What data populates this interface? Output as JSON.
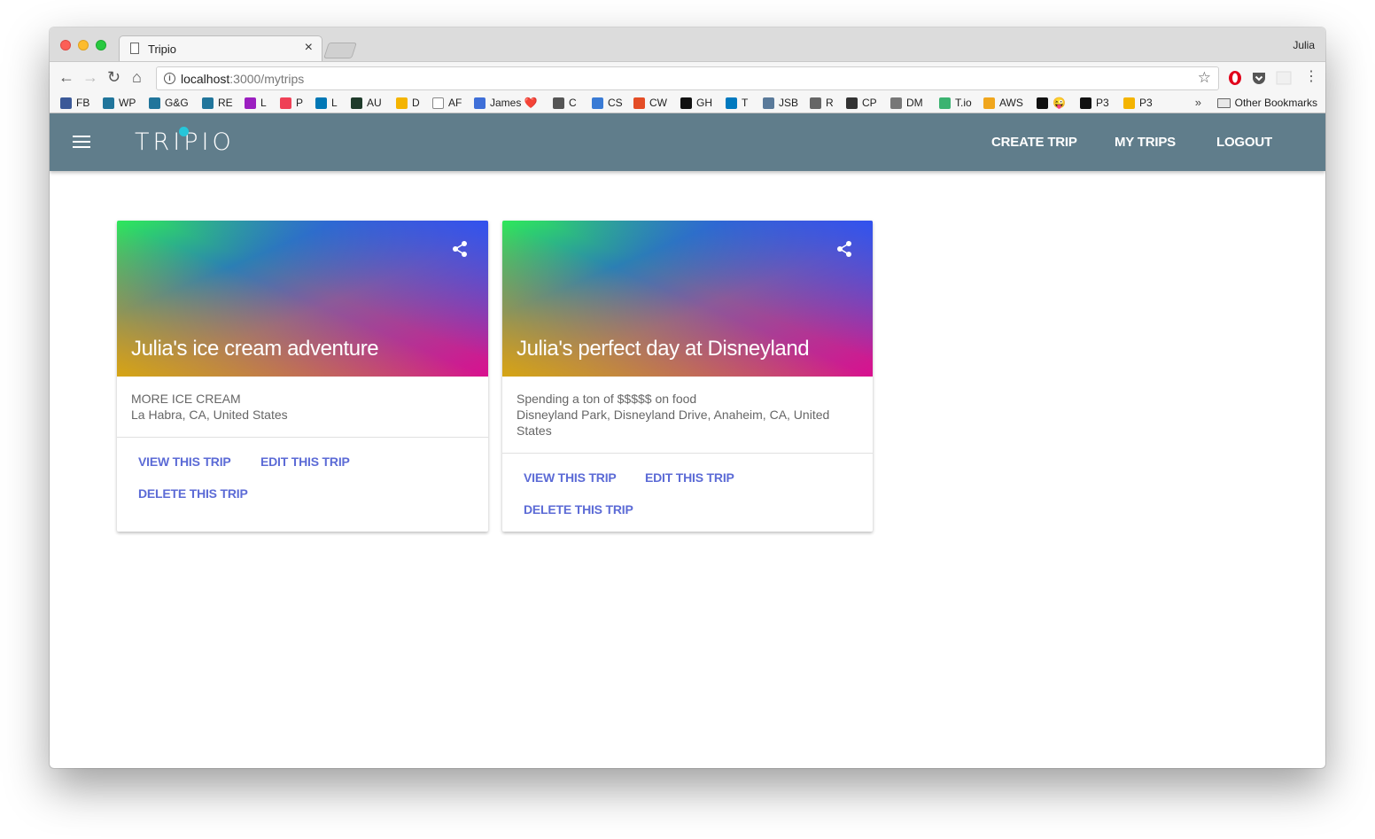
{
  "browser": {
    "tab_title": "Tripio",
    "tab_close": "×",
    "profile_name": "Julia",
    "url_host": "localhost",
    "url_path": ":3000/mytrips",
    "nav": {
      "back": "←",
      "forward": "→",
      "reload": "↻",
      "home": "⌂",
      "bookmark_star": "☆",
      "info": "i",
      "menu": "⋮"
    },
    "bookmarks": [
      {
        "label": "FB",
        "color": "#3b5998"
      },
      {
        "label": "WP",
        "color": "#21759b"
      },
      {
        "label": "G&G",
        "color": "#21759b"
      },
      {
        "label": "RE",
        "color": "#21759b"
      },
      {
        "label": "L",
        "color": "#9b1fc0"
      },
      {
        "label": "P",
        "color": "#ef4056"
      },
      {
        "label": "L",
        "color": "#0077b5"
      },
      {
        "label": "AU",
        "color": "#1f3b2b"
      },
      {
        "label": "D",
        "color": "#f4b400"
      },
      {
        "label": "AF",
        "color": "#ffffff"
      },
      {
        "label": "James ❤️",
        "color": "#3f6fd8"
      },
      {
        "label": "C",
        "color": "#555555"
      },
      {
        "label": "CS",
        "color": "#3a7bd5"
      },
      {
        "label": "CW",
        "color": "#e44d26"
      },
      {
        "label": "GH",
        "color": "#111111"
      },
      {
        "label": "T",
        "color": "#0079bf"
      },
      {
        "label": "JSB",
        "color": "#5a7a9a"
      },
      {
        "label": "R",
        "color": "#666666"
      },
      {
        "label": "CP",
        "color": "#333333"
      },
      {
        "label": "DM",
        "color": "#777777"
      },
      {
        "label": "T.io",
        "color": "#3cb371"
      },
      {
        "label": "AWS",
        "color": "#f0a61d"
      },
      {
        "label": "😜",
        "color": "#111111"
      },
      {
        "label": "P3",
        "color": "#111111"
      },
      {
        "label": "P3",
        "color": "#f4b400"
      }
    ],
    "bookmarks_more": "»",
    "other_bookmarks": "Other Bookmarks"
  },
  "app": {
    "logo": "TRIPIO",
    "brand_color": "#607d8b",
    "nav_links": [
      "CREATE TRIP",
      "MY TRIPS",
      "LOGOUT"
    ],
    "accent_color": "#5c6bd6"
  },
  "trips": [
    {
      "title": "Julia's ice cream adventure",
      "description": "MORE ICE CREAM",
      "location": "La Habra, CA, United States",
      "actions": {
        "view": "VIEW THIS TRIP",
        "edit": "EDIT THIS TRIP",
        "delete": "DELETE THIS TRIP"
      }
    },
    {
      "title": "Julia's perfect day at Disneyland",
      "description": "Spending a ton of $$$$$ on food",
      "location": "Disneyland Park, Disneyland Drive, Anaheim, CA, United States",
      "actions": {
        "view": "VIEW THIS TRIP",
        "edit": "EDIT THIS TRIP",
        "delete": "DELETE THIS TRIP"
      }
    }
  ]
}
